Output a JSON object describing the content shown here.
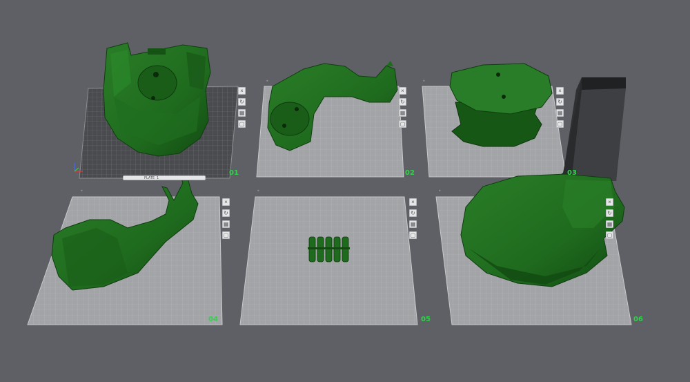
{
  "plates": [
    {
      "id": "plate-1",
      "label": "01",
      "selected": true,
      "corner_label": ""
    },
    {
      "id": "plate-2",
      "label": "02",
      "selected": false,
      "corner_label": "•"
    },
    {
      "id": "plate-3",
      "label": "03",
      "selected": false,
      "corner_label": "•"
    },
    {
      "id": "plate-4",
      "label": "04",
      "selected": false,
      "corner_label": "•"
    },
    {
      "id": "plate-5",
      "label": "05",
      "selected": false,
      "corner_label": "•"
    },
    {
      "id": "plate-6",
      "label": "06",
      "selected": false,
      "corner_label": "•"
    }
  ],
  "toolbar_icons": [
    "close-icon",
    "orient-icon",
    "arrange-icon",
    "lock-icon",
    "settings-icon"
  ],
  "toolbar_glyphs": [
    "×",
    "↻",
    "▦",
    "▢",
    "⚙"
  ],
  "selected_plate_status": "PLATE 1",
  "colors": {
    "background": "#5f6065",
    "plate_light": "#a3a4a7",
    "plate_selected": "#4a4b4e",
    "grid_light": "#b7b8ba",
    "model_green": "#1f6b1e",
    "label_green": "#2fd34a",
    "wipe_tower_dark": "#3a3b3d"
  }
}
